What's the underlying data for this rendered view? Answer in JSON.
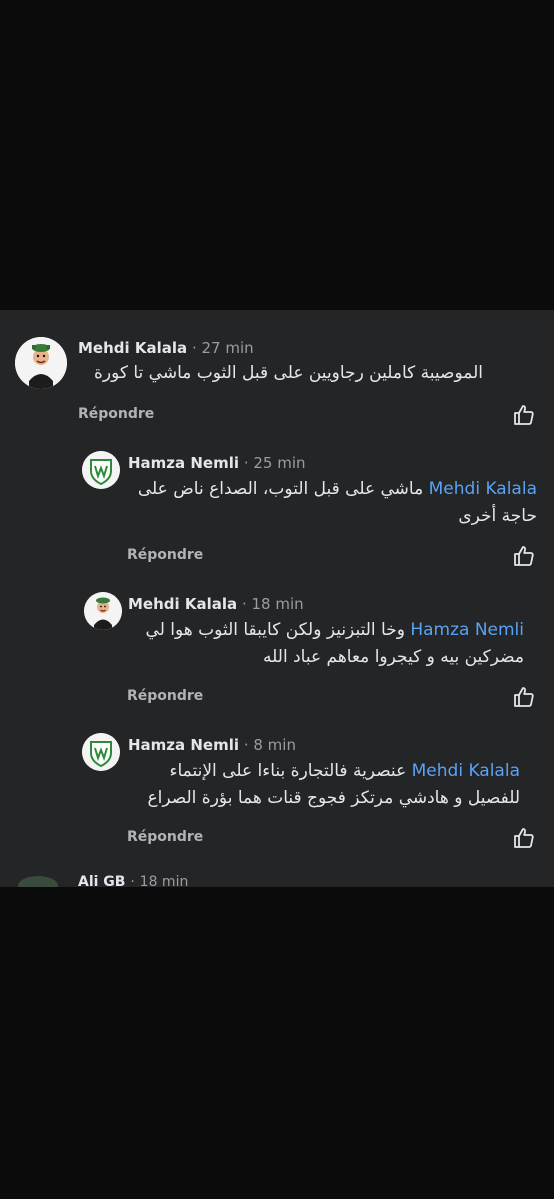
{
  "comments": [
    {
      "name": "Mehdi Kalala",
      "separator": "·",
      "time": "27 min",
      "mention": "",
      "text_line1": "الموصيبة كاملين رجاويين على قبل الثوب ماشي تا كورة",
      "text_line2": "",
      "reply_label": "Répondre",
      "avatar": "cartoon-avatar"
    },
    {
      "name": "Hamza Nemli",
      "separator": "·",
      "time": "25 min",
      "mention": "Mehdi Kalala",
      "text_line1": "ماشي على قبل التوب، الصداع ناض على",
      "text_line2": "حاجة أخرى",
      "reply_label": "Répondre",
      "avatar": "shield-logo-avatar"
    },
    {
      "name": "Mehdi Kalala",
      "separator": "·",
      "time": "18 min",
      "mention": "Hamza Nemli",
      "text_line1": "وخا التبزنيز ولكن كايبقا الثوب هوا لي",
      "text_line2": "مضركين بيه و كيجروا معاهم عباد الله",
      "reply_label": "Répondre",
      "avatar": "cartoon-avatar"
    },
    {
      "name": "Hamza Nemli",
      "separator": "·",
      "time": "8 min",
      "mention": "Mehdi Kalala",
      "text_line1": "عنصرية فالتجارة بناءا على الإنتماء",
      "text_line2": "للفصيل و هادشي مرتكز فجوج قنات هما بؤرة الصراع",
      "reply_label": "Répondre",
      "avatar": "shield-logo-avatar"
    }
  ],
  "partial_comment": {
    "name": "Ali GB",
    "separator": "·",
    "time": "18 min"
  },
  "colors": {
    "panel": "#242526",
    "mention": "#5aa2f5",
    "text": "#e4e6eb",
    "muted": "#9a9ca1"
  }
}
